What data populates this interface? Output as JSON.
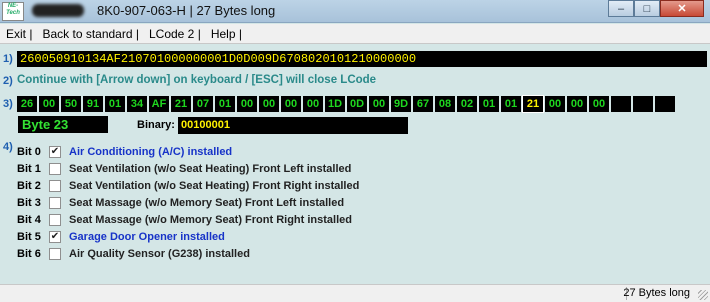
{
  "title_bar": {
    "app_icon_text": "NE-Tech",
    "title": "8K0-907-063-H | 27 Bytes long",
    "buttons": {
      "minimize": "–",
      "maximize": "□",
      "close": "✕"
    }
  },
  "menu": {
    "items": [
      "Exit |",
      "Back to standard |",
      "LCode 2 |",
      "Help |"
    ]
  },
  "step_labels": [
    "1)",
    "2)",
    "3)",
    "4)"
  ],
  "coding_string": "260050910134AF210701000000001D0D009D6708020101210000000",
  "instruction": "Continue with [Arrow down] on keyboard / [ESC] will close LCode",
  "bytes": [
    "26",
    "00",
    "50",
    "91",
    "01",
    "34",
    "AF",
    "21",
    "07",
    "01",
    "00",
    "00",
    "00",
    "00",
    "1D",
    "0D",
    "00",
    "9D",
    "67",
    "08",
    "02",
    "01",
    "01",
    "21",
    "00",
    "00",
    "00",
    "",
    "",
    ""
  ],
  "selected_byte_index": 23,
  "byte_label": "Byte 23",
  "binary_label": "Binary:",
  "binary_value": "00100001",
  "bits": [
    {
      "name": "Bit 0",
      "checked": true,
      "label": "Air Conditioning (A/C) installed"
    },
    {
      "name": "Bit 1",
      "checked": false,
      "label": "Seat Ventilation (w/o Seat Heating) Front Left installed"
    },
    {
      "name": "Bit 2",
      "checked": false,
      "label": "Seat Ventilation (w/o Seat Heating) Front Right installed"
    },
    {
      "name": "Bit 3",
      "checked": false,
      "label": "Seat Massage (w/o Memory Seat) Front Left installed"
    },
    {
      "name": "Bit 4",
      "checked": false,
      "label": "Seat Massage (w/o Memory Seat) Front Right installed"
    },
    {
      "name": "Bit 5",
      "checked": true,
      "label": "Garage Door Opener installed"
    },
    {
      "name": "Bit 6",
      "checked": false,
      "label": "Air Quality Sensor (G238) installed"
    }
  ],
  "status_bar": {
    "text": "27 Bytes long"
  },
  "colors": {
    "checked_label": "#1733c8",
    "byte_text": "#1fd71f",
    "selected_byte_text": "#fff200",
    "step_label": "#1f5fb0"
  }
}
